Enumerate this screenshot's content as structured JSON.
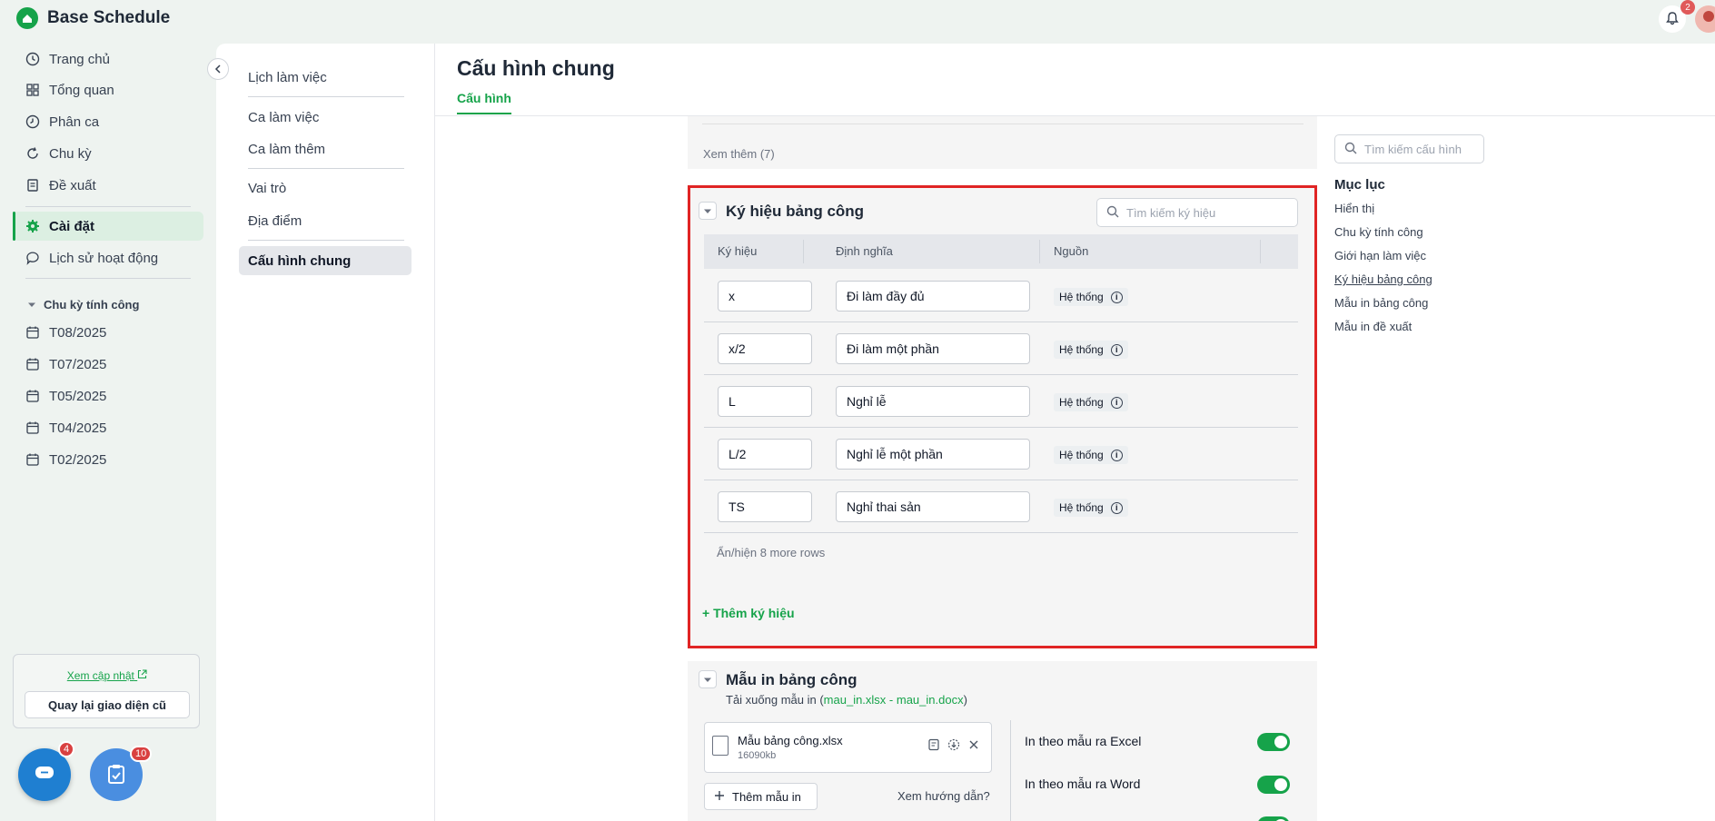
{
  "app": {
    "name": "Base Schedule",
    "notification_count": "2"
  },
  "sidebar": {
    "items": [
      {
        "label": "Trang chủ",
        "icon": "clock-icon"
      },
      {
        "label": "Tổng quan",
        "icon": "grid-icon"
      },
      {
        "label": "Phân ca",
        "icon": "clock-icon"
      },
      {
        "label": "Chu kỳ",
        "icon": "refresh-icon"
      },
      {
        "label": "Đề xuất",
        "icon": "document-icon"
      },
      {
        "label": "Cài đặt",
        "icon": "gear-icon",
        "active": true
      },
      {
        "label": "Lịch sử hoạt động",
        "icon": "chat-icon"
      }
    ],
    "cycle_section_title": "Chu kỳ tính công",
    "cycles": [
      "T08/2025",
      "T07/2025",
      "T05/2025",
      "T04/2025",
      "T02/2025"
    ],
    "update_link": "Xem cập nhật",
    "back_button": "Quay lại giao diện cũ",
    "chat_badge": "4",
    "task_badge": "10"
  },
  "submenu": {
    "items": [
      "Lịch làm việc",
      "Ca làm việc",
      "Ca làm thêm",
      "Vai trò",
      "Địa điểm",
      "Cấu hình chung"
    ],
    "active": "Cấu hình chung"
  },
  "page": {
    "title": "Cấu hình chung",
    "tab": "Cấu hình",
    "see_more": "Xem thêm (7)"
  },
  "symbols": {
    "title": "Ký hiệu bảng công",
    "search_placeholder": "Tìm kiếm ký hiệu",
    "columns": [
      "Ký hiệu",
      "Định nghĩa",
      "Nguồn"
    ],
    "rows": [
      {
        "code": "x",
        "definition": "Đi làm đầy đủ",
        "source": "Hệ thống"
      },
      {
        "code": "x/2",
        "definition": "Đi làm một phần",
        "source": "Hệ thống"
      },
      {
        "code": "L",
        "definition": "Nghỉ lễ",
        "source": "Hệ thống"
      },
      {
        "code": "L/2",
        "definition": "Nghỉ lễ một phần",
        "source": "Hệ thống"
      },
      {
        "code": "TS",
        "definition": "Nghỉ thai sản",
        "source": "Hệ thống"
      }
    ],
    "toggle_rows": "Ẩn/hiện 8 more rows",
    "add_label": "+ Thêm ký hiệu"
  },
  "print_templates": {
    "title": "Mẫu in bảng công",
    "download_prefix": "Tải xuống mẫu in (",
    "xlsx_link": "mau_in.xlsx",
    "separator": " - ",
    "docx_link": "mau_in.docx",
    "download_suffix": ")",
    "file_name": "Mẫu bảng công.xlsx",
    "file_size": "16090kb",
    "add_template": "Thêm mẫu in",
    "guide_link": "Xem hướng dẫn?",
    "options": [
      {
        "label": "In theo mẫu ra Excel",
        "enabled": true
      },
      {
        "label": "In theo mẫu ra Word",
        "enabled": true
      }
    ]
  },
  "toc": {
    "search_placeholder": "Tìm kiếm cấu hình",
    "title": "Mục lục",
    "items": [
      "Hiển thị",
      "Chu kỳ tính công",
      "Giới hạn làm việc",
      "Ký hiệu bảng công",
      "Mẫu in bảng công",
      "Mẫu in đề xuất"
    ],
    "current": "Ký hiệu bảng công"
  },
  "colors": {
    "accent": "#16a34a",
    "highlight_border": "#e02424",
    "badge": "#d94040"
  }
}
